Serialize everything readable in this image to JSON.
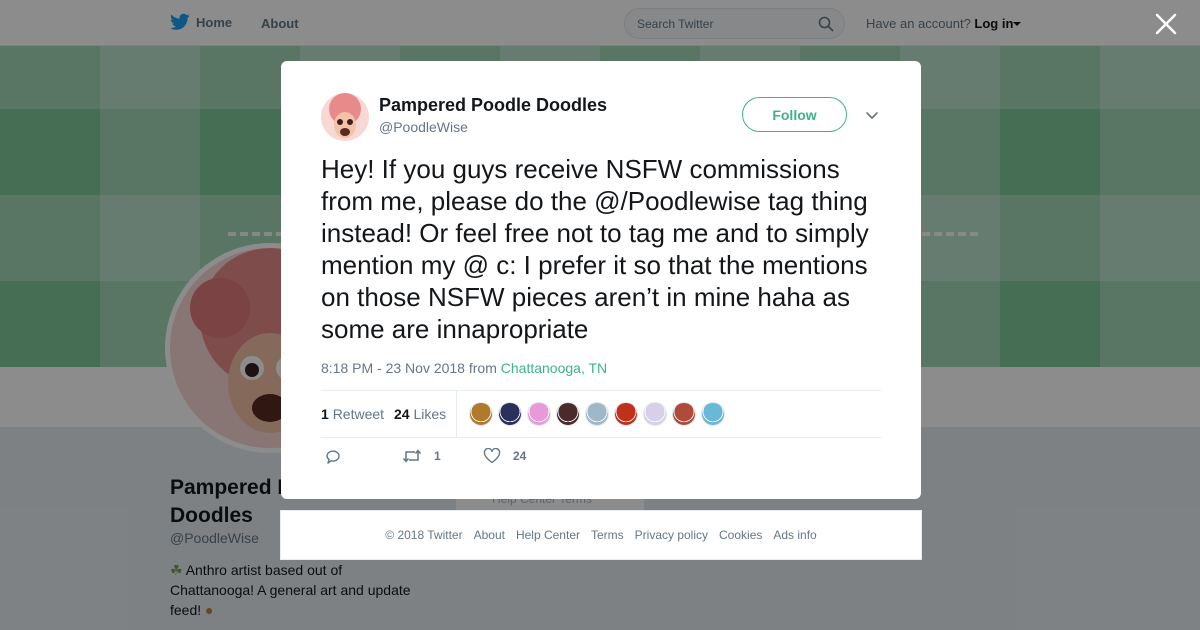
{
  "nav": {
    "home_label": "Home",
    "about_label": "About",
    "search_placeholder": "Search Twitter",
    "have_account": "Have an account?",
    "login_label": "Log in"
  },
  "background_profile": {
    "name": "Pampered Poodle Doodles",
    "handle": "@PoodleWise",
    "bio": "Anthro artist based out of Chattanooga! A general art and update feed!",
    "footer_ghost": "Help Center   Terms"
  },
  "colors": {
    "accent": "#3db38c",
    "banner": "#7ec89c",
    "text": "#14171a",
    "muted": "#657786"
  },
  "tweet": {
    "author_name": "Pampered Poodle Doodles",
    "author_handle": "@PoodleWise",
    "follow_label": "Follow",
    "text": "Hey! If you guys receive NSFW commissions from me, please do the @/Poodlewise tag thing instead! Or feel free not to tag me and to simply mention my @ c: I prefer it so that the mentions on those NSFW pieces aren’t in mine haha as some are innapropriate",
    "time": "8:18 PM - 23 Nov 2018",
    "from_label": "from",
    "location": "Chattanooga, TN",
    "retweet_count": "1",
    "retweet_label": "Retweet",
    "like_count": "24",
    "like_label": "Likes",
    "action_retweet_count": "1",
    "action_like_count": "24",
    "likers": [
      "#b07a2a",
      "#2a2f5c",
      "#e89ad8",
      "#4a2a2a",
      "#9fb8c8",
      "#c0301a",
      "#d8d0e8",
      "#b04a3a",
      "#6ab8d8"
    ]
  },
  "footer": {
    "copyright": "© 2018 Twitter",
    "about": "About",
    "help": "Help Center",
    "terms": "Terms",
    "privacy": "Privacy policy",
    "cookies": "Cookies",
    "ads": "Ads info"
  }
}
